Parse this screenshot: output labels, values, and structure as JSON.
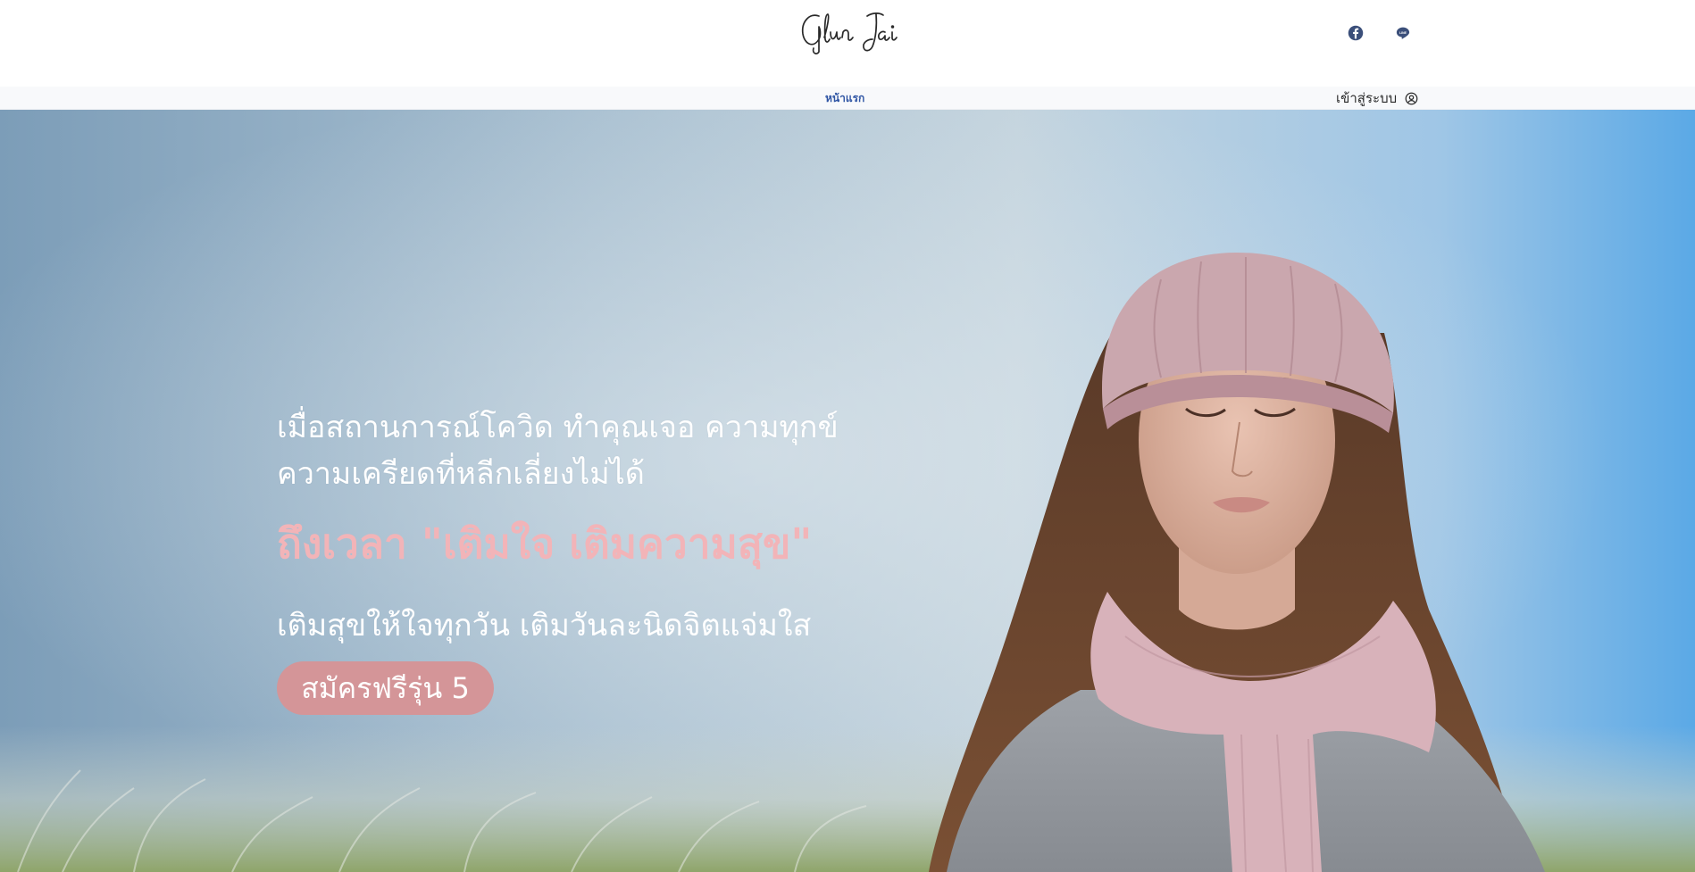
{
  "header": {
    "logo_text": "Glun Jai",
    "social": [
      {
        "name": "facebook",
        "icon": "facebook-icon"
      },
      {
        "name": "line",
        "icon": "line-icon"
      }
    ]
  },
  "nav": {
    "home_label": "หน้าแรก",
    "login_label": "เข้าสู่ระบบ",
    "login_icon": "user-circle-icon"
  },
  "hero": {
    "intro_line1": "เมื่อสถานการณ์โควิด ทำคุณเจอ ความทุกข์",
    "intro_line2": "ความเครียดที่หลีกเลี่ยงไม่ได้",
    "headline": "ถึงเวลา \"เติมใจ เติมความสุข\"",
    "subheadline": "เติมสุขให้ใจทุกวัน เติมวันละนิดจิตแจ่มใส",
    "cta_label": "สมัครฟรีรุ่น 5"
  },
  "colors": {
    "nav_link": "#2f55a4",
    "headline": "#f2b4b8",
    "cta_background": "#d49598",
    "sky_right": "#5aaae6"
  }
}
